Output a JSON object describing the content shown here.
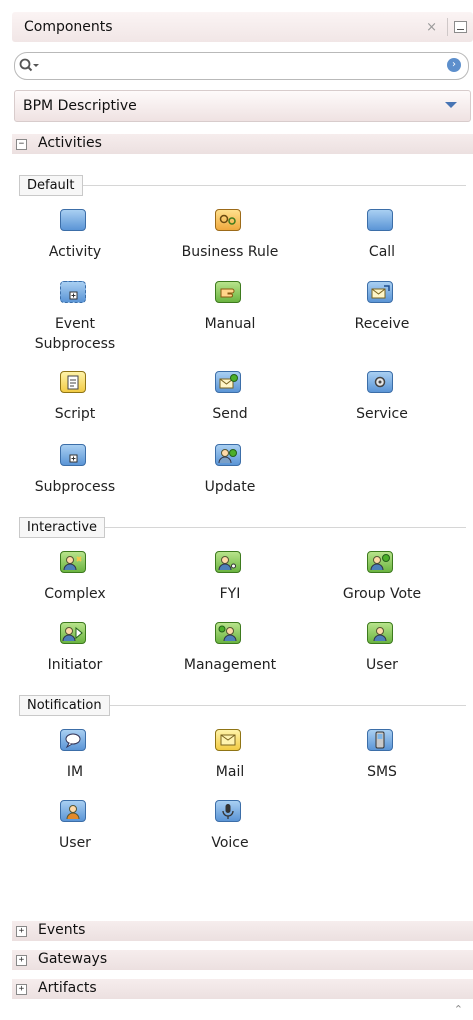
{
  "panel": {
    "title": "Components",
    "close_glyph": "×"
  },
  "search": {
    "value": "",
    "placeholder": ""
  },
  "catalog": {
    "selected": "BPM Descriptive"
  },
  "sections": {
    "activities": "Activities",
    "events": "Events",
    "gateways": "Gateways",
    "artifacts": "Artifacts"
  },
  "groups": {
    "default": "Default",
    "interactive": "Interactive",
    "notification": "Notification"
  },
  "items": {
    "activity": "Activity",
    "business_rule": "Business Rule",
    "call": "Call",
    "event_subprocess": "Event\nSubprocess",
    "manual": "Manual",
    "receive": "Receive",
    "script": "Script",
    "send": "Send",
    "service": "Service",
    "subprocess": "Subprocess",
    "update": "Update",
    "complex": "Complex",
    "fyi": "FYI",
    "group_vote": "Group Vote",
    "initiator": "Initiator",
    "management": "Management",
    "user_interactive": "User",
    "im": "IM",
    "mail": "Mail",
    "sms": "SMS",
    "user_notification": "User",
    "voice": "Voice"
  },
  "icons": {
    "activity": "blue-square-icon",
    "business_rule": "gears-icon",
    "call": "blue-square-icon",
    "event_subprocess": "dashed-subprocess-icon",
    "manual": "hand-icon",
    "receive": "envelope-in-icon",
    "script": "scroll-icon",
    "send": "envelope-out-icon",
    "service": "gear-icon",
    "subprocess": "subprocess-icon",
    "update": "update-person-icon",
    "complex": "person-complex-icon",
    "fyi": "person-fyi-icon",
    "group_vote": "person-vote-icon",
    "initiator": "person-play-icon",
    "management": "person-management-icon",
    "user_interactive": "person-icon",
    "im": "chat-bubble-icon",
    "mail": "envelope-icon",
    "sms": "phone-icon",
    "user_notification": "person-icon",
    "voice": "microphone-icon"
  },
  "scroll_glyph": "⌃"
}
